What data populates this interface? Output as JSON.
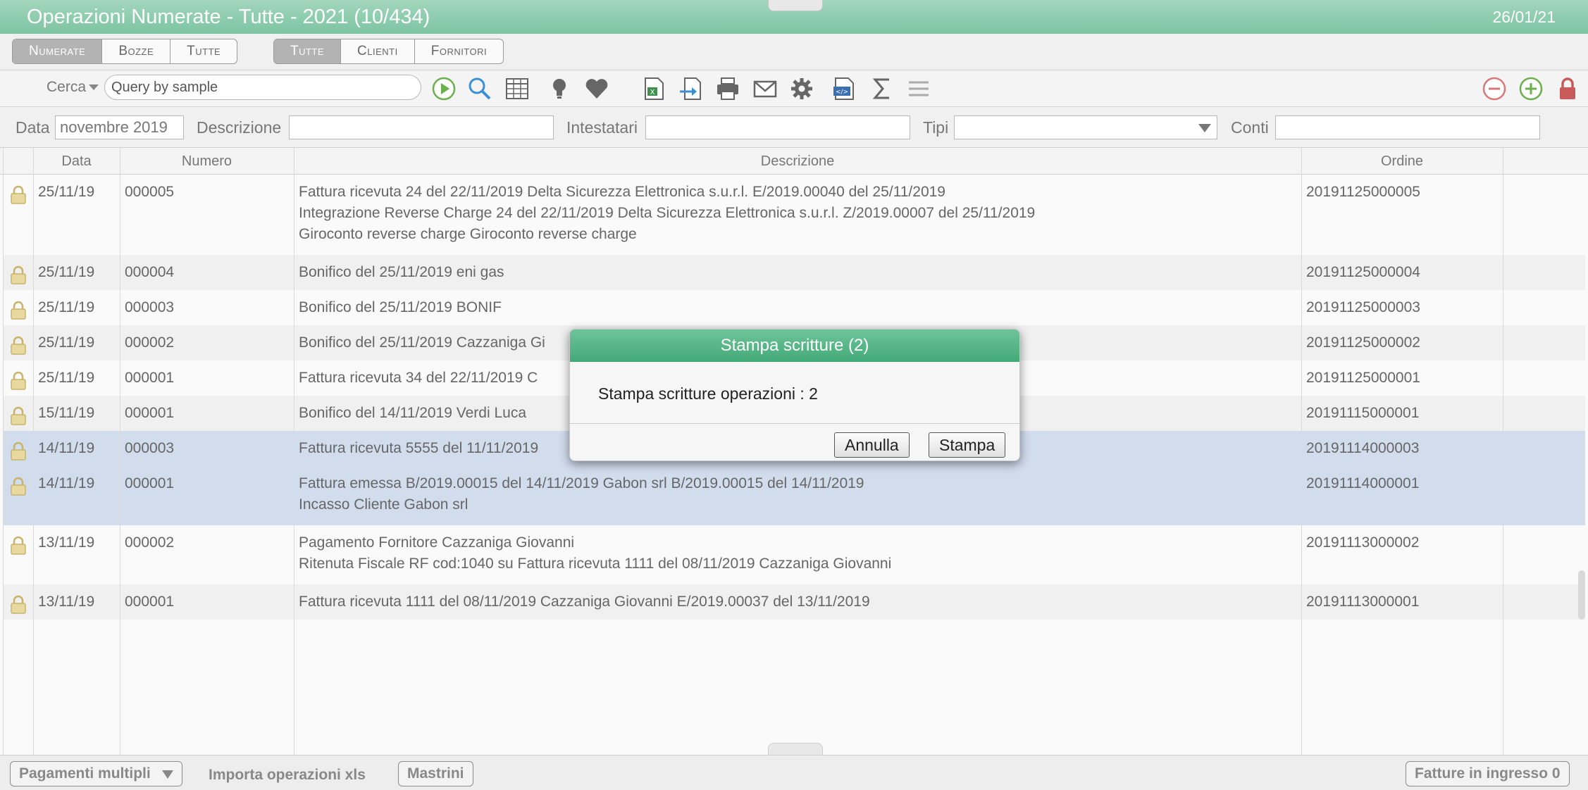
{
  "window": {
    "title": "Operazioni Numerate - Tutte - 2021 (10/434)",
    "date": "26/01/21"
  },
  "tabs": {
    "group1": [
      {
        "label": "Numerate",
        "active": true
      },
      {
        "label": "Bozze",
        "active": false
      },
      {
        "label": "Tutte",
        "active": false
      }
    ],
    "group2": [
      {
        "label": "Tutte",
        "active": true
      },
      {
        "label": "Clienti",
        "active": false
      },
      {
        "label": "Fornitori",
        "active": false
      }
    ]
  },
  "toolbar": {
    "search_menu_label": "Cerca",
    "search_value": "Query by sample",
    "icons": [
      "play-icon",
      "magnifier-icon",
      "grid-icon",
      "lightbulb-icon",
      "heart-icon",
      "excel-icon",
      "import-icon",
      "print-icon",
      "mail-icon",
      "gear-icon",
      "xml-icon",
      "sigma-icon",
      "menu-icon"
    ],
    "right_icons": [
      "remove-icon",
      "add-icon",
      "lock-icon"
    ]
  },
  "filters": {
    "data_label": "Data",
    "data_value": "novembre 2019",
    "descrizione_label": "Descrizione",
    "descrizione_value": "",
    "intestatari_label": "Intestatari",
    "intestatari_value": "",
    "tipi_label": "Tipi",
    "tipi_value": "",
    "conti_label": "Conti",
    "conti_value": ""
  },
  "table": {
    "columns": [
      "Data",
      "Numero",
      "Descrizione",
      "Ordine"
    ],
    "rows": [
      {
        "data": "25/11/19",
        "numero": "000005",
        "descrizione": [
          "Fattura ricevuta 24 del 22/11/2019 Delta Sicurezza Elettronica s.u.r.l. E/2019.00040 del 25/11/2019",
          "Integrazione Reverse Charge 24 del 22/11/2019 Delta Sicurezza Elettronica s.u.r.l. Z/2019.00007 del 25/11/2019",
          "Giroconto reverse charge Giroconto reverse charge"
        ],
        "ordine": "20191125000005",
        "selected": false
      },
      {
        "data": "25/11/19",
        "numero": "000004",
        "descrizione": [
          "Bonifico del 25/11/2019 eni gas"
        ],
        "ordine": "20191125000004",
        "selected": false
      },
      {
        "data": "25/11/19",
        "numero": "000003",
        "descrizione": [
          "Bonifico del 25/11/2019 BONIF"
        ],
        "ordine": "20191125000003",
        "selected": false
      },
      {
        "data": "25/11/19",
        "numero": "000002",
        "descrizione": [
          "Bonifico del 25/11/2019 Cazzaniga Gi"
        ],
        "ordine": "20191125000002",
        "selected": false
      },
      {
        "data": "25/11/19",
        "numero": "000001",
        "descrizione": [
          "Fattura ricevuta 34 del 22/11/2019 C"
        ],
        "ordine": "20191125000001",
        "selected": false
      },
      {
        "data": "15/11/19",
        "numero": "000001",
        "descrizione": [
          "Bonifico del 14/11/2019 Verdi Luca"
        ],
        "ordine": "20191115000001",
        "selected": false
      },
      {
        "data": "14/11/19",
        "numero": "000003",
        "descrizione": [
          "Fattura ricevuta 5555 del 11/11/2019"
        ],
        "ordine": "20191114000003",
        "selected": true
      },
      {
        "data": "14/11/19",
        "numero": "000001",
        "descrizione": [
          "Fattura emessa B/2019.00015 del 14/11/2019 Gabon srl B/2019.00015 del 14/11/2019",
          "Incasso Cliente Gabon srl"
        ],
        "ordine": "20191114000001",
        "selected": true
      },
      {
        "data": "13/11/19",
        "numero": "000002",
        "descrizione": [
          "Pagamento Fornitore Cazzaniga Giovanni",
          "Ritenuta Fiscale RF cod:1040 su Fattura ricevuta 1111 del 08/11/2019 Cazzaniga Giovanni"
        ],
        "ordine": "20191113000002",
        "selected": false
      },
      {
        "data": "13/11/19",
        "numero": "000001",
        "descrizione": [
          "Fattura ricevuta 1111 del 08/11/2019 Cazzaniga Giovanni E/2019.00037 del 13/11/2019"
        ],
        "ordine": "20191113000001",
        "selected": false
      }
    ]
  },
  "dialog": {
    "title": "Stampa scritture (2)",
    "message": "Stampa scritture operazioni : 2",
    "cancel_label": "Annulla",
    "confirm_label": "Stampa"
  },
  "footer": {
    "pagamenti_label": "Pagamenti multipli",
    "importa_label": "Importa operazioni xls",
    "mastrini_label": "Mastrini",
    "fatture_label": "Fatture in ingresso 0"
  }
}
